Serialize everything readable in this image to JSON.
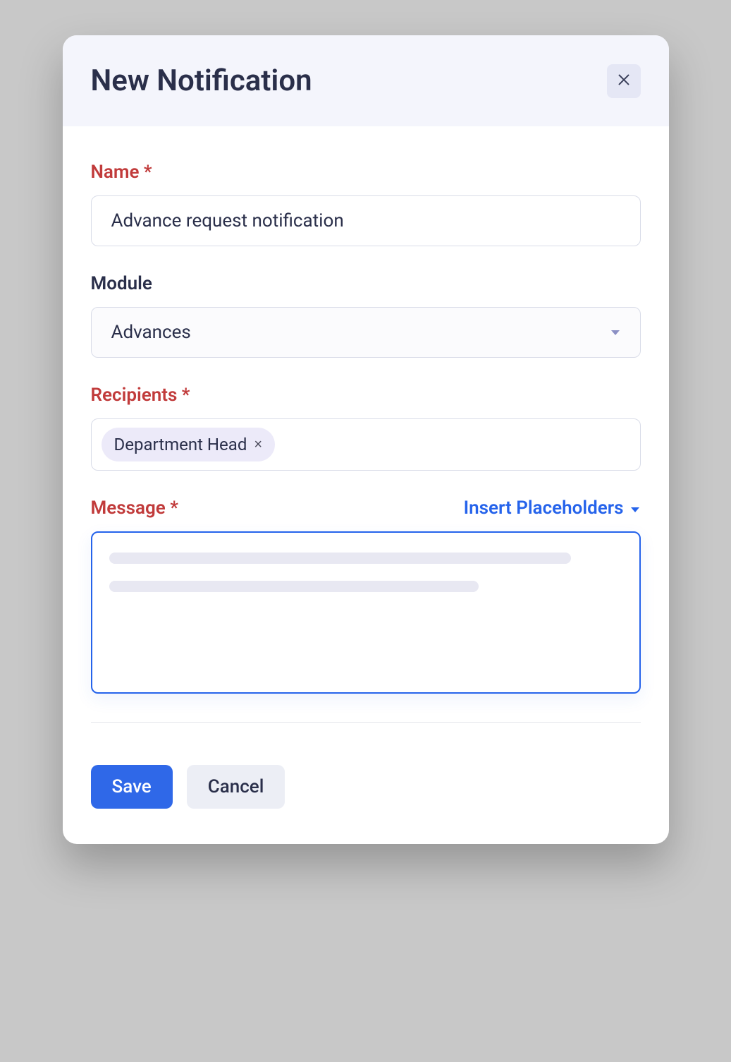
{
  "header": {
    "title": "New Notification"
  },
  "form": {
    "name_label": "Name",
    "name_value": "Advance request notification",
    "module_label": "Module",
    "module_value": "Advances",
    "recipients_label": "Recipients",
    "recipients": [
      {
        "label": "Department Head"
      }
    ],
    "message_label": "Message",
    "insert_placeholders_label": "Insert Placeholders"
  },
  "footer": {
    "save_label": "Save",
    "cancel_label": "Cancel"
  }
}
